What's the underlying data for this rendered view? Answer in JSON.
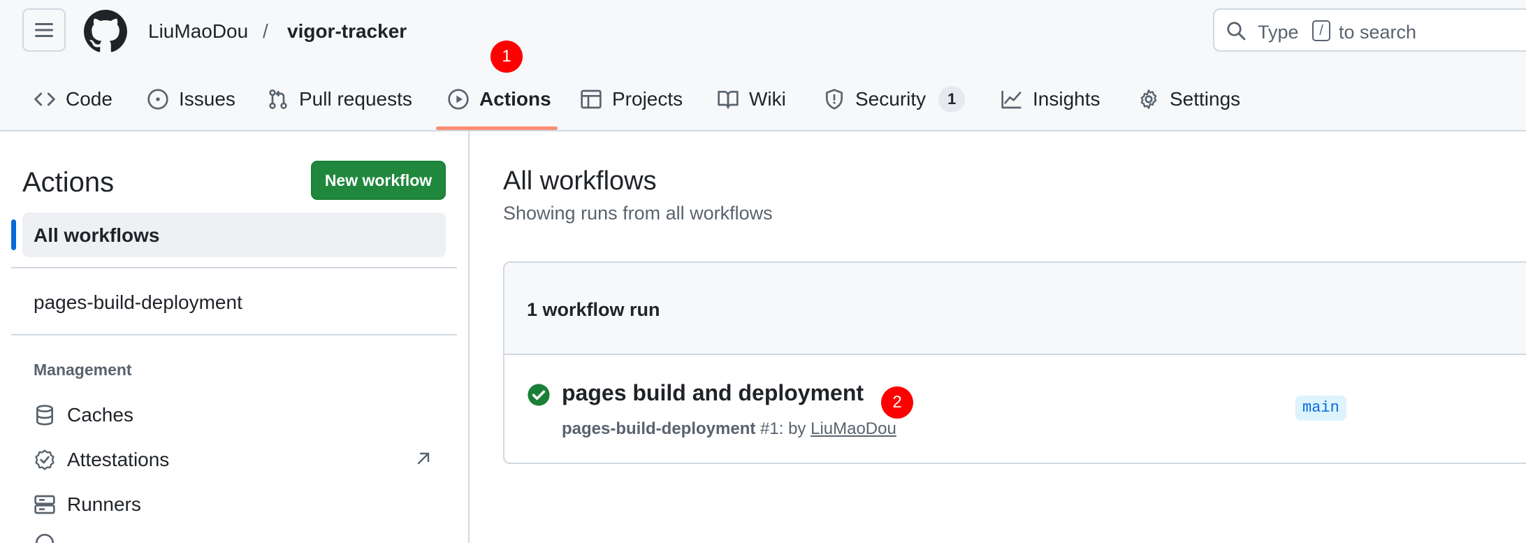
{
  "header": {
    "owner": "LiuMaoDou",
    "separator": "/",
    "repo": "vigor-tracker",
    "search": {
      "prefix": "Type",
      "key": "/",
      "suffix": "to search"
    },
    "icons": {
      "menu": "hamburger-icon",
      "logo": "github-mark-icon",
      "search": "search-icon"
    }
  },
  "tabs": [
    {
      "label": "Code",
      "icon": "code-icon"
    },
    {
      "label": "Issues",
      "icon": "issue-opened-icon"
    },
    {
      "label": "Pull requests",
      "icon": "git-pull-request-icon"
    },
    {
      "label": "Actions",
      "icon": "play-icon",
      "active": true
    },
    {
      "label": "Projects",
      "icon": "table-icon"
    },
    {
      "label": "Wiki",
      "icon": "book-icon"
    },
    {
      "label": "Security",
      "icon": "shield-icon",
      "counter": "1"
    },
    {
      "label": "Insights",
      "icon": "graph-icon"
    },
    {
      "label": "Settings",
      "icon": "gear-icon"
    }
  ],
  "markers": [
    "1",
    "2"
  ],
  "sidebar": {
    "title": "Actions",
    "new_workflow": "New workflow",
    "items": [
      {
        "label": "All workflows",
        "selected": true
      },
      {
        "label": "pages-build-deployment"
      }
    ],
    "management_heading": "Management",
    "management": [
      {
        "label": "Caches",
        "icon": "database-icon"
      },
      {
        "label": "Attestations",
        "icon": "verified-icon",
        "external": true
      },
      {
        "label": "Runners",
        "icon": "server-icon"
      }
    ]
  },
  "main": {
    "title": "All workflows",
    "subtitle": "Showing runs from all workflows",
    "runs_count": "1 workflow run",
    "runs": [
      {
        "title": "pages build and deployment",
        "workflow": "pages-build-deployment",
        "run": "#1: by",
        "actor": "LiuMaoDou",
        "branch": "main",
        "status": "success"
      }
    ]
  },
  "colors": {
    "accent": "#0969da",
    "primary_button": "#1f883d",
    "success": "#1a7f37",
    "tab_underline": "#fd8c73",
    "marker": "#ff0000"
  }
}
